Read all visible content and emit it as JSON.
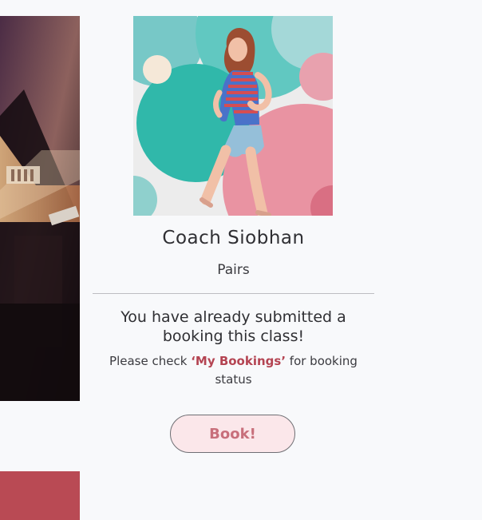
{
  "coach": {
    "name": "Coach Siobhan",
    "class_type": "Pairs"
  },
  "notice": {
    "title": "You have already submitted a booking this class!",
    "body_before": "Please check ",
    "body_highlight": "‘My Bookings’",
    "body_after": " for booking status"
  },
  "actions": {
    "book_label": "Book!"
  },
  "colors": {
    "page_bg": "#f8f9fb",
    "accent_red": "#b94a54",
    "highlight_text": "#b44452",
    "button_bg": "#fbe7ea",
    "button_text": "#c86f7b"
  }
}
